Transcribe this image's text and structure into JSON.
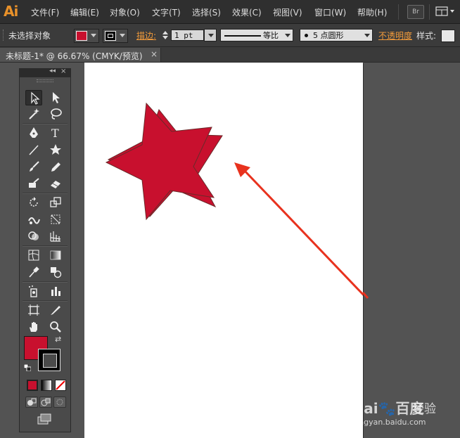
{
  "app": {
    "logo": "Ai",
    "bridge_label": "Br"
  },
  "menu": [
    {
      "label": "文件(F)"
    },
    {
      "label": "编辑(E)"
    },
    {
      "label": "对象(O)"
    },
    {
      "label": "文字(T)"
    },
    {
      "label": "选择(S)"
    },
    {
      "label": "效果(C)"
    },
    {
      "label": "视图(V)"
    },
    {
      "label": "窗口(W)"
    },
    {
      "label": "帮助(H)"
    }
  ],
  "control": {
    "selection": "未选择对象",
    "stroke_label": "描边:",
    "stroke_weight": "1 pt",
    "profile_label": "等比",
    "brush_label": "5 点圆形",
    "opacity_label": "不透明度",
    "style_label": "样式:"
  },
  "document": {
    "tab_title": "未标题-1* @ 66.67% (CMYK/预览)",
    "close_glyph": "×"
  },
  "tools_panel": {
    "collapse_glyph": "◂◂",
    "close_glyph": "×",
    "swap_glyph": "⇄"
  },
  "colors": {
    "fill": "#c8102e",
    "stroke": "#000000",
    "accent": "#e8912a",
    "arrow": "#e8321e"
  },
  "watermark": {
    "brand": "Bai🐾百度",
    "product": "经验",
    "url": "jingyan.baidu.com"
  }
}
